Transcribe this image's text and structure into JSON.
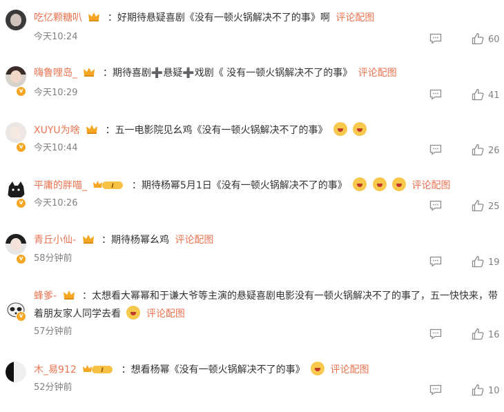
{
  "comments": [
    {
      "username": "吃亿颗糖叭",
      "text": "：好期待悬疑喜剧《没有一顿火锅解决不了的事》啊",
      "pic_link": "评论配图",
      "time": "今天10:24",
      "likes": "60"
    },
    {
      "username": "嗨鲁哩岛_",
      "text": "：期待喜剧➕悬疑➕戏剧《 没有一顿火锅解决不了的事》",
      "pic_link": "评论配图",
      "time": "今天10:29",
      "likes": "41"
    },
    {
      "username": "XUYU为啥",
      "text": "：五一电影院见幺鸡《没有一顿火锅解决不了的事》",
      "pic_link": "",
      "time": "今天10:44",
      "likes": "26"
    },
    {
      "username": "平庸的胖喵_",
      "text": "：期待杨幂5月1日《没有一顿火锅解决不了的事》",
      "pic_link": "评论配图",
      "time": "今天10:26",
      "likes": "25"
    },
    {
      "username": "青丘小仙-",
      "text": "：期待杨幂幺鸡",
      "pic_link": "评论配图",
      "time": "58分钟前",
      "likes": "19"
    },
    {
      "username": "蜂爹-",
      "text": "：太想看大幂幂和于谦大爷等主演的悬疑喜剧电影没有一顿火锅解决不了的事了，五一快快来，带着朋友家人同学去看",
      "pic_link": "评论配图",
      "time": "57分钟前",
      "likes": "16"
    },
    {
      "username": "木_易912",
      "text": "：想看杨幂《没有一顿火锅解决不了的事》",
      "pic_link": "评论配图",
      "time": "52分钟前",
      "likes": "10"
    }
  ],
  "icons": {
    "reply": "comment-icon",
    "like": "thumbs-up-icon",
    "crown": "crown-icon",
    "vip": "vip-level-badge",
    "verified": "verified-badge-icon",
    "emoji": "emoji-icon"
  },
  "colors": {
    "username": "#eb7350",
    "time": "#808080",
    "text": "#333333",
    "crown": "#f5a623"
  }
}
